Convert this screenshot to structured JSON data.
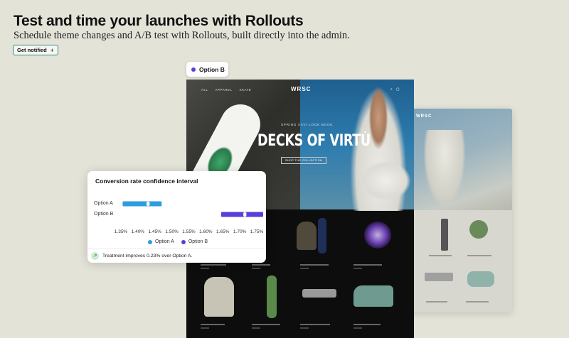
{
  "header": {
    "title": "Test and time your launches with Rollouts",
    "subtitle": "Schedule theme changes and A/B test with Rollouts, built directly into the admin.",
    "cta_label": "Get notified",
    "cta_icon": "plus-icon"
  },
  "option_tag": {
    "label": "Option B",
    "dot_color": "#5a3ed8"
  },
  "storefront": {
    "logo": "WRSC",
    "nav": [
      "ALL",
      "APPAREL",
      "SKATE"
    ],
    "eyebrow": "SPRING XXVI LOOK BOOK",
    "hero_title": "DECKS OF VIRTÙ",
    "hero_button": "SHOP THE COLLECTION"
  },
  "chart_card": {
    "title": "Conversion rate confidence interval",
    "footer_text": "Treatment improves 0.23% over Option A.",
    "footer_icon": "trend-up-icon"
  },
  "chart_data": {
    "type": "interval",
    "title": "Conversion rate confidence interval",
    "x_ticks": [
      "1.35%",
      "1.40%",
      "1.45%",
      "1.50%",
      "1.55%",
      "1.60%",
      "1.65%",
      "1.70%",
      "1.75%"
    ],
    "xlim": [
      1.35,
      1.75
    ],
    "series": [
      {
        "name": "Option A",
        "low": 1.355,
        "high": 1.47,
        "point": 1.43,
        "color": "#2d9de0"
      },
      {
        "name": "Option B",
        "low": 1.645,
        "high": 1.8,
        "point": 1.715,
        "color": "#5a3ed8"
      }
    ],
    "legend_position": "bottom"
  }
}
